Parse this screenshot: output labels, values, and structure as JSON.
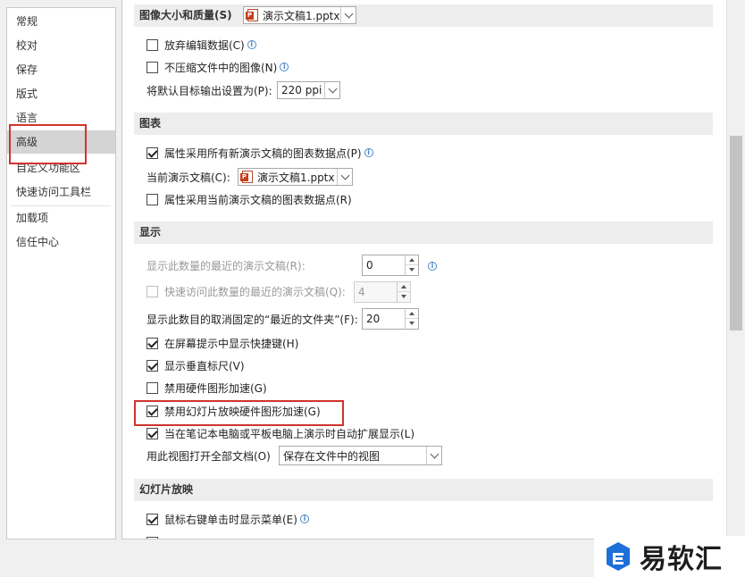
{
  "sidebar": {
    "items": [
      {
        "label": "常规"
      },
      {
        "label": "校对"
      },
      {
        "label": "保存"
      },
      {
        "label": "版式"
      },
      {
        "label": "语言"
      },
      {
        "label": "高级"
      },
      {
        "label": "自定义功能区"
      },
      {
        "label": "快速访问工具栏"
      },
      {
        "label": "加载项"
      },
      {
        "label": "信任中心"
      }
    ],
    "active": "高级"
  },
  "image_section": {
    "header": "图像大小和质量(S)",
    "file_dropdown": "演示文稿1.pptx",
    "discard_edit_data": {
      "label": "放弃编辑数据(C)",
      "checked": false
    },
    "no_compress": {
      "label": "不压缩文件中的图像(N)",
      "checked": false
    },
    "default_target_label": "将默认目标输出设置为(P):",
    "default_target_value": "220 ppi"
  },
  "chart_section": {
    "header": "图表",
    "new_docs_datapoints": {
      "label": "属性采用所有新演示文稿的图表数据点(P)",
      "checked": true
    },
    "current_doc_label": "当前演示文稿(C):",
    "current_doc_value": "演示文稿1.pptx",
    "current_doc_datapoints": {
      "label": "属性采用当前演示文稿的图表数据点(R)",
      "checked": false
    }
  },
  "display_section": {
    "header": "显示",
    "recent_docs_label": "显示此数量的最近的演示文稿(R):",
    "recent_docs_value": "0",
    "quick_access_label": "快速访问此数量的最近的演示文稿(Q):",
    "quick_access_value": "4",
    "recent_folders_label": "显示此数目的取消固定的“最近的文件夹”(F):",
    "recent_folders_value": "20",
    "shortcut_keys": {
      "label": "在屏幕提示中显示快捷键(H)",
      "checked": true
    },
    "vertical_ruler": {
      "label": "显示垂直标尺(V)",
      "checked": true
    },
    "disable_hw_accel": {
      "label": "禁用硬件图形加速(G)",
      "checked": false
    },
    "disable_slideshow_accel": {
      "label": "禁用幻灯片放映硬件图形加速(G)",
      "checked": true
    },
    "auto_extend": {
      "label": "当在笔记本电脑或平板电脑上演示时自动扩展显示(L)",
      "checked": true
    },
    "open_view_label": "用此视图打开全部文档(O)",
    "open_view_value": "保存在文件中的视图"
  },
  "slideshow_section": {
    "header": "幻灯片放映",
    "right_click_menu": {
      "label": "鼠标右键单击时显示菜单(E)",
      "checked": true
    }
  },
  "watermark": {
    "text": "易软汇"
  },
  "colors": {
    "highlight": "#d0342c",
    "logo_blue": "#1e6fd9"
  }
}
